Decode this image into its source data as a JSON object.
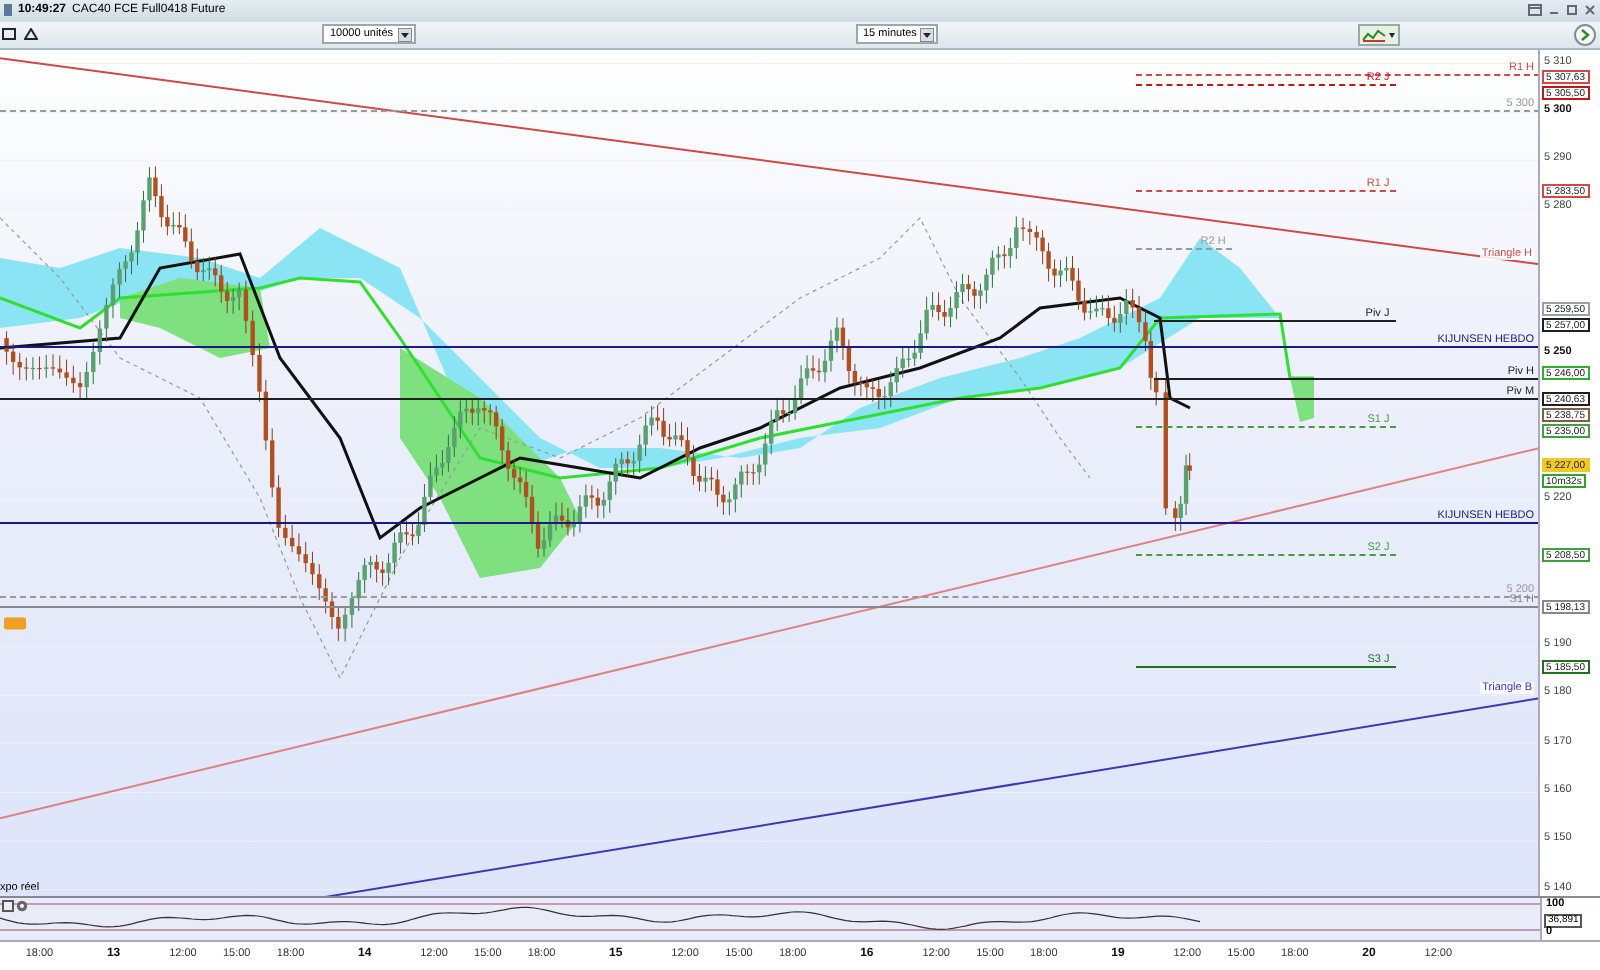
{
  "window": {
    "time": "10:49:27",
    "title": "CAC40 FCE Full0418 Future"
  },
  "toolbar": {
    "quantity": "10000 unités",
    "interval": "15 minutes"
  },
  "price_chart": {
    "price_axis": [
      {
        "label": "5 310",
        "kind": "minor"
      },
      {
        "label": "5 300",
        "kind": "major"
      },
      {
        "label": "5 290",
        "kind": "minor"
      },
      {
        "label": "5 280",
        "kind": "minor"
      },
      {
        "label": "5 250",
        "kind": "major"
      },
      {
        "label": "5 220",
        "kind": "minor"
      },
      {
        "label": "5 190",
        "kind": "minor"
      },
      {
        "label": "5 180",
        "kind": "minor"
      },
      {
        "label": "5 170",
        "kind": "minor"
      },
      {
        "label": "5 160",
        "kind": "minor"
      },
      {
        "label": "5 150",
        "kind": "minor"
      },
      {
        "label": "5 140",
        "kind": "minor"
      }
    ],
    "lines": [
      {
        "kind": "level",
        "label": "R1 H",
        "tag": "5 307,63",
        "color": "#d04848",
        "dashed": true
      },
      {
        "kind": "level",
        "label": "R2 J",
        "tag": "5 305,50",
        "color": "#c01818",
        "dashed": true
      },
      {
        "kind": "level",
        "label": "5 300",
        "color": "#999999",
        "dashed": true
      },
      {
        "kind": "level",
        "label": "R1 J",
        "tag": "5 283,50",
        "color": "#d04848",
        "dashed": true
      },
      {
        "kind": "level",
        "label": "R2 H",
        "color": "#999999",
        "dashed": true
      },
      {
        "kind": "trend",
        "label": "Triangle H",
        "color": "#d04848"
      },
      {
        "kind": "tag",
        "tag": "5 259,50",
        "color": "#9aa0a8"
      },
      {
        "kind": "level",
        "label": "Piv J",
        "tag": "5 257,00",
        "color": "#202020",
        "dashed": false
      },
      {
        "kind": "level",
        "label": "KIJUNSEN HEBDO",
        "color": "#1a1a80",
        "dashed": false
      },
      {
        "kind": "tag",
        "tag": "5 246,00",
        "color": "#30b030"
      },
      {
        "kind": "level",
        "label": "Piv H",
        "color": "#202020",
        "dashed": false
      },
      {
        "kind": "level",
        "label": "Piv M",
        "tag": "5 240,63",
        "color": "#202020",
        "dashed": false
      },
      {
        "kind": "tag",
        "tag": "5 238,75",
        "color": "#806040"
      },
      {
        "kind": "level",
        "label": "S1 J",
        "tag": "5 235,00",
        "color": "#40a040",
        "dashed": true
      },
      {
        "kind": "price",
        "tag": "5 227,00",
        "color": "#f0c828"
      },
      {
        "kind": "tag",
        "tag": "10m32s",
        "color": "#30a030"
      },
      {
        "kind": "level",
        "label": "KIJUNSEN HEBDO",
        "color": "#1a1a80",
        "dashed": false
      },
      {
        "kind": "level",
        "label": "S2 J",
        "tag": "5 208,50",
        "color": "#40a040",
        "dashed": true
      },
      {
        "kind": "level",
        "label": "5 200",
        "color": "#999999",
        "dashed": true
      },
      {
        "kind": "level",
        "label": "S1 H",
        "tag": "5 198,13",
        "color": "#888888",
        "dashed": false
      },
      {
        "kind": "level",
        "label": "S3 J",
        "tag": "5 185,50",
        "color": "#207020",
        "dashed": false
      },
      {
        "kind": "trend",
        "label": "Triangle B",
        "color": "#3a3ab0"
      },
      {
        "kind": "trend",
        "color": "#e08080"
      }
    ],
    "time_axis": [
      {
        "label": "18:00",
        "kind": "hour"
      },
      {
        "label": "13",
        "kind": "day"
      },
      {
        "label": "12:00",
        "kind": "hour"
      },
      {
        "label": "15:00",
        "kind": "hour"
      },
      {
        "label": "18:00",
        "kind": "hour"
      },
      {
        "label": "14",
        "kind": "day"
      },
      {
        "label": "12:00",
        "kind": "hour"
      },
      {
        "label": "15:00",
        "kind": "hour"
      },
      {
        "label": "18:00",
        "kind": "hour"
      },
      {
        "label": "15",
        "kind": "day"
      },
      {
        "label": "12:00",
        "kind": "hour"
      },
      {
        "label": "15:00",
        "kind": "hour"
      },
      {
        "label": "18:00",
        "kind": "hour"
      },
      {
        "label": "16",
        "kind": "day"
      },
      {
        "label": "12:00",
        "kind": "hour"
      },
      {
        "label": "15:00",
        "kind": "hour"
      },
      {
        "label": "18:00",
        "kind": "hour"
      },
      {
        "label": "19",
        "kind": "day"
      },
      {
        "label": "12:00",
        "kind": "hour"
      },
      {
        "label": "15:00",
        "kind": "hour"
      },
      {
        "label": "18:00",
        "kind": "hour"
      },
      {
        "label": "20",
        "kind": "day"
      },
      {
        "label": "12:00",
        "kind": "hour"
      }
    ]
  },
  "oscillator": {
    "label": "xpo réel",
    "ticks": [
      "100",
      "0"
    ],
    "reading": "36,891"
  }
}
